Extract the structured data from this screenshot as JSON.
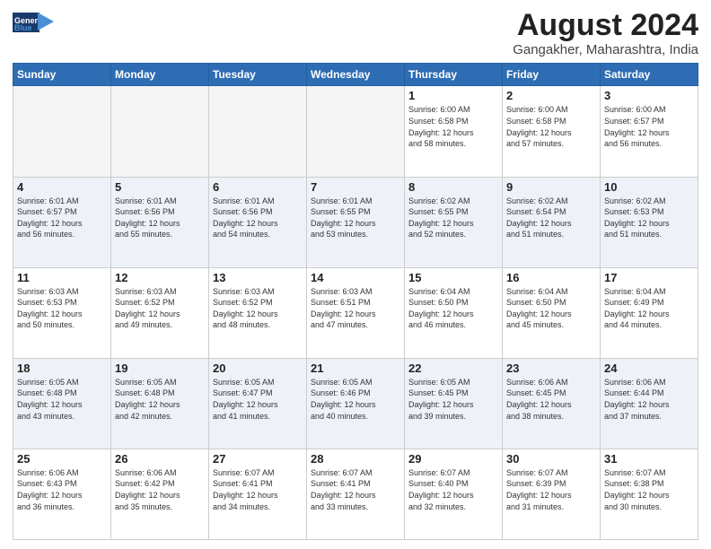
{
  "header": {
    "logo_line1": "General",
    "logo_line2": "Blue",
    "main_title": "August 2024",
    "sub_title": "Gangakher, Maharashtra, India"
  },
  "calendar": {
    "days_of_week": [
      "Sunday",
      "Monday",
      "Tuesday",
      "Wednesday",
      "Thursday",
      "Friday",
      "Saturday"
    ],
    "weeks": [
      [
        {
          "day": "",
          "info": ""
        },
        {
          "day": "",
          "info": ""
        },
        {
          "day": "",
          "info": ""
        },
        {
          "day": "",
          "info": ""
        },
        {
          "day": "1",
          "info": "Sunrise: 6:00 AM\nSunset: 6:58 PM\nDaylight: 12 hours\nand 58 minutes."
        },
        {
          "day": "2",
          "info": "Sunrise: 6:00 AM\nSunset: 6:58 PM\nDaylight: 12 hours\nand 57 minutes."
        },
        {
          "day": "3",
          "info": "Sunrise: 6:00 AM\nSunset: 6:57 PM\nDaylight: 12 hours\nand 56 minutes."
        }
      ],
      [
        {
          "day": "4",
          "info": "Sunrise: 6:01 AM\nSunset: 6:57 PM\nDaylight: 12 hours\nand 56 minutes."
        },
        {
          "day": "5",
          "info": "Sunrise: 6:01 AM\nSunset: 6:56 PM\nDaylight: 12 hours\nand 55 minutes."
        },
        {
          "day": "6",
          "info": "Sunrise: 6:01 AM\nSunset: 6:56 PM\nDaylight: 12 hours\nand 54 minutes."
        },
        {
          "day": "7",
          "info": "Sunrise: 6:01 AM\nSunset: 6:55 PM\nDaylight: 12 hours\nand 53 minutes."
        },
        {
          "day": "8",
          "info": "Sunrise: 6:02 AM\nSunset: 6:55 PM\nDaylight: 12 hours\nand 52 minutes."
        },
        {
          "day": "9",
          "info": "Sunrise: 6:02 AM\nSunset: 6:54 PM\nDaylight: 12 hours\nand 51 minutes."
        },
        {
          "day": "10",
          "info": "Sunrise: 6:02 AM\nSunset: 6:53 PM\nDaylight: 12 hours\nand 51 minutes."
        }
      ],
      [
        {
          "day": "11",
          "info": "Sunrise: 6:03 AM\nSunset: 6:53 PM\nDaylight: 12 hours\nand 50 minutes."
        },
        {
          "day": "12",
          "info": "Sunrise: 6:03 AM\nSunset: 6:52 PM\nDaylight: 12 hours\nand 49 minutes."
        },
        {
          "day": "13",
          "info": "Sunrise: 6:03 AM\nSunset: 6:52 PM\nDaylight: 12 hours\nand 48 minutes."
        },
        {
          "day": "14",
          "info": "Sunrise: 6:03 AM\nSunset: 6:51 PM\nDaylight: 12 hours\nand 47 minutes."
        },
        {
          "day": "15",
          "info": "Sunrise: 6:04 AM\nSunset: 6:50 PM\nDaylight: 12 hours\nand 46 minutes."
        },
        {
          "day": "16",
          "info": "Sunrise: 6:04 AM\nSunset: 6:50 PM\nDaylight: 12 hours\nand 45 minutes."
        },
        {
          "day": "17",
          "info": "Sunrise: 6:04 AM\nSunset: 6:49 PM\nDaylight: 12 hours\nand 44 minutes."
        }
      ],
      [
        {
          "day": "18",
          "info": "Sunrise: 6:05 AM\nSunset: 6:48 PM\nDaylight: 12 hours\nand 43 minutes."
        },
        {
          "day": "19",
          "info": "Sunrise: 6:05 AM\nSunset: 6:48 PM\nDaylight: 12 hours\nand 42 minutes."
        },
        {
          "day": "20",
          "info": "Sunrise: 6:05 AM\nSunset: 6:47 PM\nDaylight: 12 hours\nand 41 minutes."
        },
        {
          "day": "21",
          "info": "Sunrise: 6:05 AM\nSunset: 6:46 PM\nDaylight: 12 hours\nand 40 minutes."
        },
        {
          "day": "22",
          "info": "Sunrise: 6:05 AM\nSunset: 6:45 PM\nDaylight: 12 hours\nand 39 minutes."
        },
        {
          "day": "23",
          "info": "Sunrise: 6:06 AM\nSunset: 6:45 PM\nDaylight: 12 hours\nand 38 minutes."
        },
        {
          "day": "24",
          "info": "Sunrise: 6:06 AM\nSunset: 6:44 PM\nDaylight: 12 hours\nand 37 minutes."
        }
      ],
      [
        {
          "day": "25",
          "info": "Sunrise: 6:06 AM\nSunset: 6:43 PM\nDaylight: 12 hours\nand 36 minutes."
        },
        {
          "day": "26",
          "info": "Sunrise: 6:06 AM\nSunset: 6:42 PM\nDaylight: 12 hours\nand 35 minutes."
        },
        {
          "day": "27",
          "info": "Sunrise: 6:07 AM\nSunset: 6:41 PM\nDaylight: 12 hours\nand 34 minutes."
        },
        {
          "day": "28",
          "info": "Sunrise: 6:07 AM\nSunset: 6:41 PM\nDaylight: 12 hours\nand 33 minutes."
        },
        {
          "day": "29",
          "info": "Sunrise: 6:07 AM\nSunset: 6:40 PM\nDaylight: 12 hours\nand 32 minutes."
        },
        {
          "day": "30",
          "info": "Sunrise: 6:07 AM\nSunset: 6:39 PM\nDaylight: 12 hours\nand 31 minutes."
        },
        {
          "day": "31",
          "info": "Sunrise: 6:07 AM\nSunset: 6:38 PM\nDaylight: 12 hours\nand 30 minutes."
        }
      ]
    ]
  }
}
